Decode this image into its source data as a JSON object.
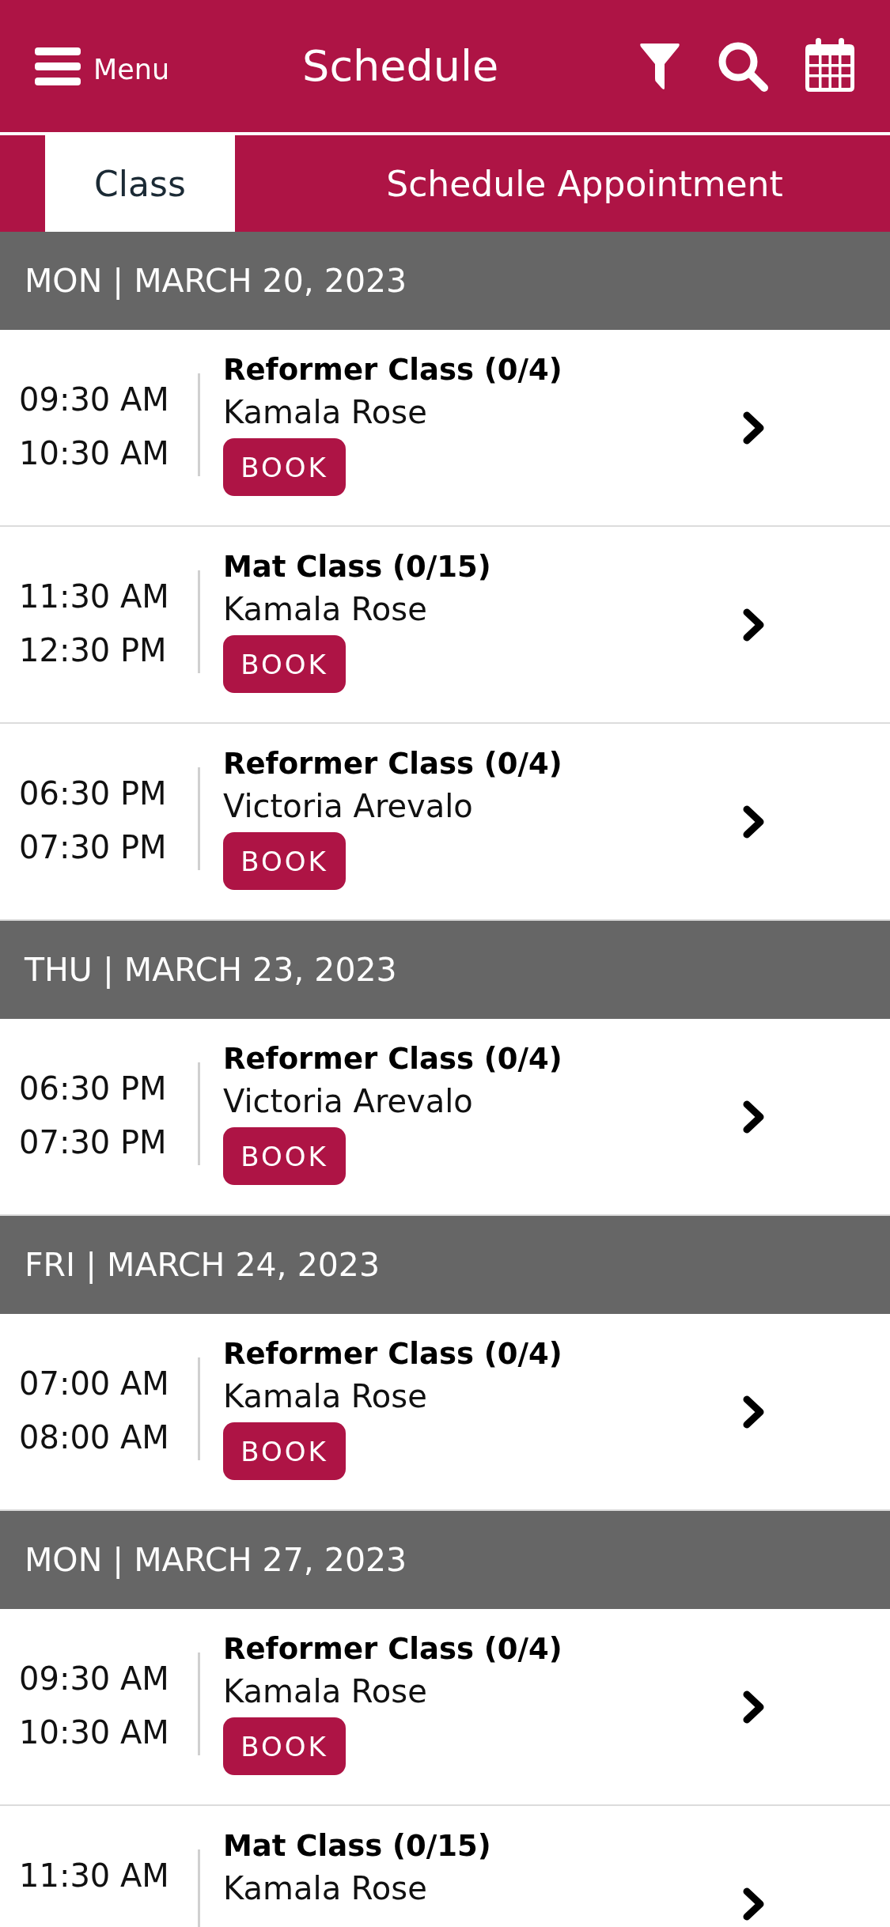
{
  "header": {
    "menu_label": "Menu",
    "title": "Schedule"
  },
  "tabs": [
    {
      "label": "Class",
      "selected": true
    },
    {
      "label": "Schedule Appointment",
      "selected": false
    }
  ],
  "days": [
    {
      "date": "MON | MARCH 20, 2023",
      "classes": [
        {
          "start": "09:30 AM",
          "end": "10:30 AM",
          "title": "Reformer Class (0/4)",
          "instructor": "Kamala Rose",
          "book": "BOOK"
        },
        {
          "start": "11:30 AM",
          "end": "12:30 PM",
          "title": "Mat Class (0/15)",
          "instructor": "Kamala Rose",
          "book": "BOOK"
        },
        {
          "start": "06:30 PM",
          "end": "07:30 PM",
          "title": "Reformer Class (0/4)",
          "instructor": "Victoria Arevalo",
          "book": "BOOK"
        }
      ]
    },
    {
      "date": "THU | MARCH 23, 2023",
      "classes": [
        {
          "start": "06:30 PM",
          "end": "07:30 PM",
          "title": "Reformer Class (0/4)",
          "instructor": "Victoria Arevalo",
          "book": "BOOK"
        }
      ]
    },
    {
      "date": "FRI | MARCH 24, 2023",
      "classes": [
        {
          "start": "07:00 AM",
          "end": "08:00 AM",
          "title": "Reformer Class (0/4)",
          "instructor": "Kamala Rose",
          "book": "BOOK"
        }
      ]
    },
    {
      "date": "MON | MARCH 27, 2023",
      "classes": [
        {
          "start": "09:30 AM",
          "end": "10:30 AM",
          "title": "Reformer Class (0/4)",
          "instructor": "Kamala Rose",
          "book": "BOOK"
        },
        {
          "start": "11:30 AM",
          "title": "Mat Class (0/15)",
          "instructor": "Kamala Rose"
        }
      ]
    }
  ]
}
